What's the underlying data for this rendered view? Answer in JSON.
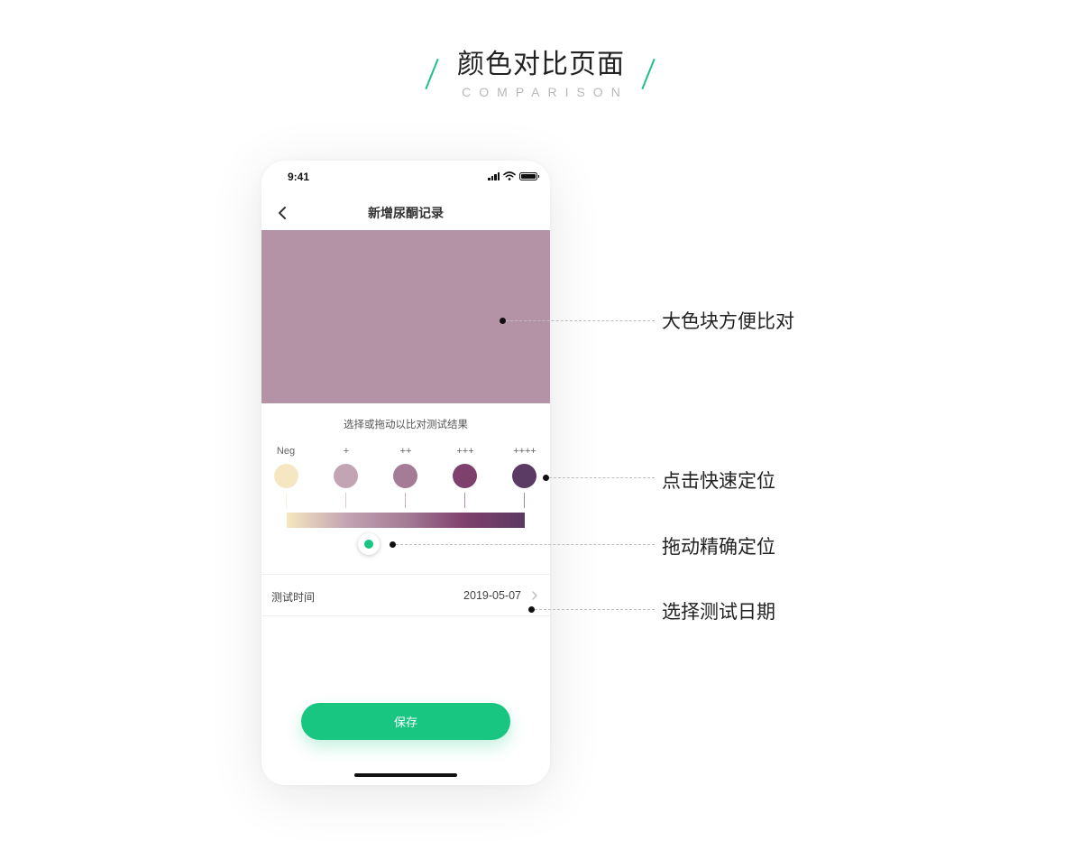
{
  "header": {
    "title": "颜色对比页面",
    "subtitle": "COMPARISON",
    "accent_color": "#1fbf86"
  },
  "phone": {
    "status_bar": {
      "time": "9:41",
      "icons": [
        "signal-icon",
        "wifi-icon",
        "battery-icon"
      ]
    },
    "nav": {
      "back_icon": "chevron-left-icon",
      "title": "新增尿酮记录"
    },
    "selected_color": "#b493a6",
    "hint": "选择或拖动以比对测试结果",
    "levels": [
      {
        "label": "Neg",
        "color": "#f5e7c1"
      },
      {
        "label": "+",
        "color": "#c3a4b2"
      },
      {
        "label": "++",
        "color": "#a47c96"
      },
      {
        "label": "+++",
        "color": "#7e406c"
      },
      {
        "label": "++++",
        "color": "#5b3a63"
      }
    ],
    "gradient_colors": [
      "#f5e7c1",
      "#c3a4b2",
      "#a47c96",
      "#7e406c",
      "#5b3a63"
    ],
    "slider": {
      "thumb_color": "#18c682",
      "position_fraction": 0.35
    },
    "date_row": {
      "label": "测试时间",
      "value": "2019-05-07",
      "icon": "chevron-right-icon"
    },
    "save_button": {
      "label": "保存",
      "color": "#18c682"
    }
  },
  "annotations": [
    {
      "text": "大色块方便比对"
    },
    {
      "text": "点击快速定位"
    },
    {
      "text": "拖动精确定位"
    },
    {
      "text": "选择测试日期"
    }
  ]
}
